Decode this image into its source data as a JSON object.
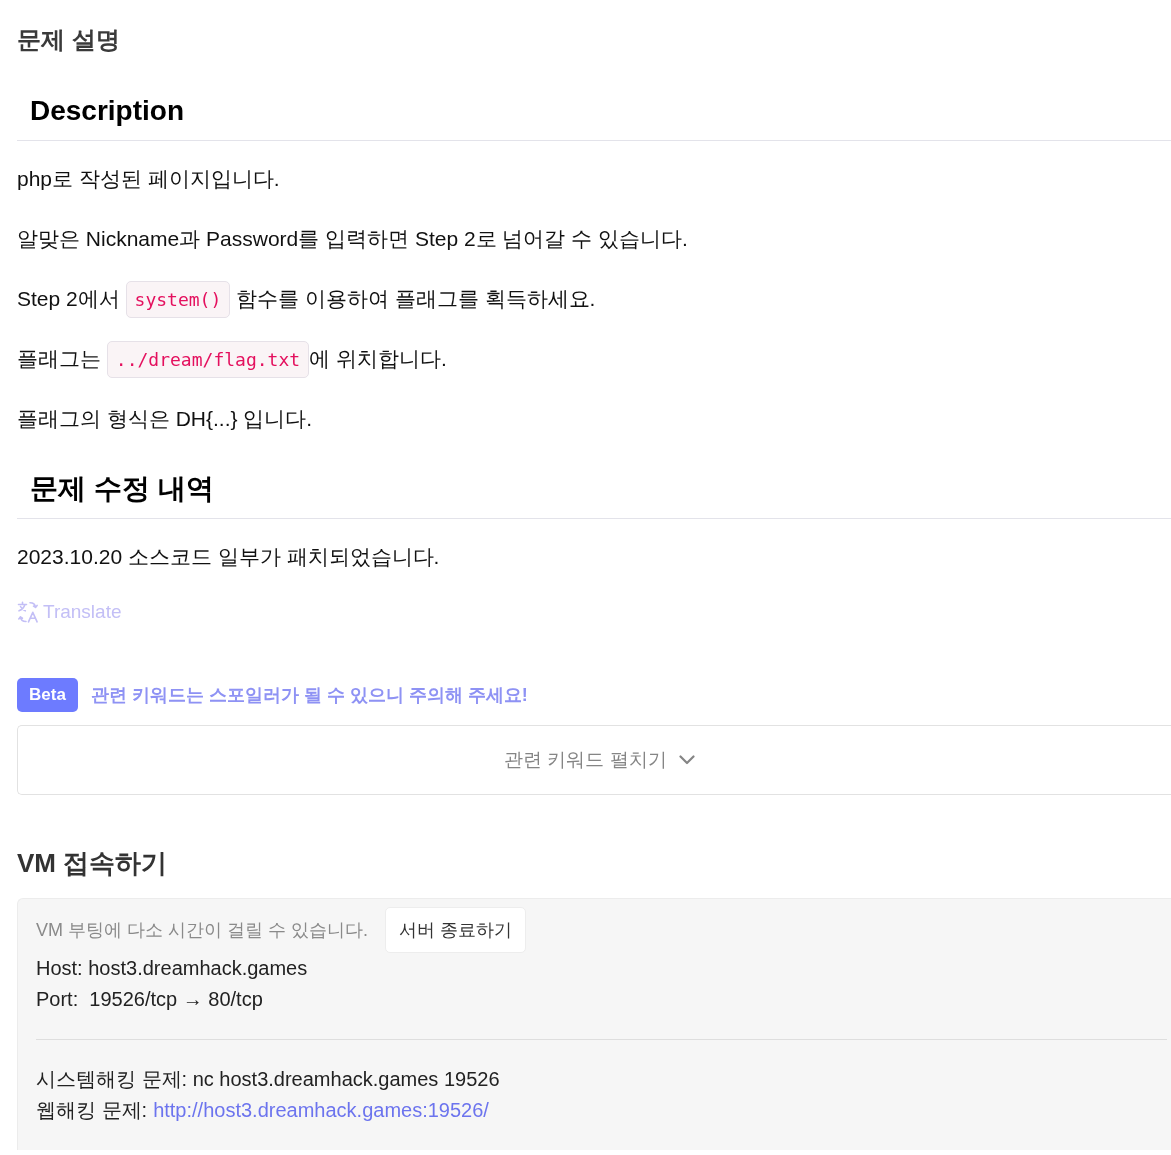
{
  "page_title": "문제 설명",
  "description": {
    "heading": "Description",
    "paragraphs": [
      [
        {
          "kind": "text",
          "text": "php로 작성된 페이지입니다."
        }
      ],
      [
        {
          "kind": "text",
          "text": "알맞은 Nickname과 Password를 입력하면 Step 2로 넘어갈 수 있습니다."
        }
      ],
      [
        {
          "kind": "text",
          "text": "Step 2에서 "
        },
        {
          "kind": "code",
          "text": "system()"
        },
        {
          "kind": "text",
          "text": " 함수를 이용하여 플래그를 획득하세요."
        }
      ],
      [
        {
          "kind": "text",
          "text": "플래그는 "
        },
        {
          "kind": "code",
          "text": "../dream/flag.txt"
        },
        {
          "kind": "text",
          "text": "에 위치합니다."
        }
      ],
      [
        {
          "kind": "text",
          "text": "플래그의 형식은 DH{...} 입니다."
        }
      ]
    ]
  },
  "changelog": {
    "heading": "문제 수정 내역",
    "paragraphs": [
      [
        {
          "kind": "text",
          "text": "2023.10.20 소스코드 일부가 패치되었습니다."
        }
      ]
    ]
  },
  "translate": {
    "label": "Translate"
  },
  "keywords": {
    "badge": "Beta",
    "warning": "관련 키워드는 스포일러가 될 수 있으니 주의해 주세요!",
    "toggle": "관련 키워드 펼치기",
    "expanded": false
  },
  "vm": {
    "title": "VM 접속하기",
    "notice": "VM 부팅에 다소 시간이 걸릴 수 있습니다.",
    "stop_button": "서버 종료하기",
    "host": "Host: host3.dreamhack.games",
    "port": "Port:  19526/tcp → 80/tcp",
    "system_hacking": "시스템해킹 문제: nc host3.dreamhack.games 19526",
    "web_hacking_label": "웹해킹 문제:",
    "web_hacking_link": "http://host3.dreamhack.games:19526/"
  }
}
